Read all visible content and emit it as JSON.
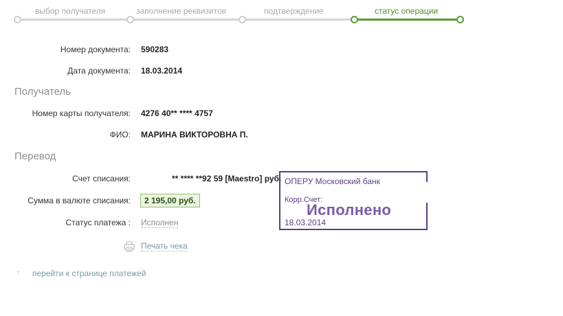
{
  "steps": [
    {
      "label": "выбор получателя",
      "active": false
    },
    {
      "label": "заполнение реквизитов",
      "active": false
    },
    {
      "label": "подтверждение",
      "active": false
    },
    {
      "label": "статус операции",
      "active": true
    }
  ],
  "document": {
    "number_label": "Номер документа:",
    "number_value": "590283",
    "date_label": "Дата документа:",
    "date_value": "18.03.2014"
  },
  "recipient": {
    "section_title": "Получатель",
    "card_label": "Номер карты получателя:",
    "card_value": "4276 40** **** 4757",
    "name_label": "ФИО:",
    "name_value": "МАРИНА ВИКТОРОВНА П."
  },
  "transfer": {
    "section_title": "Перевод",
    "account_label": "Счет списания:",
    "account_value": "** **** **92 59  [Maestro]  руб.",
    "amount_label": "Сумма в валюте списания:",
    "amount_value": "2 195,00  руб.",
    "status_label": "Статус платежа :",
    "status_value": "Исполнен"
  },
  "actions": {
    "print_label": "Печать чека",
    "back_label": "перейти к странице платежей"
  },
  "stamp": {
    "bank": "ОПЕРУ Московский банк",
    "corr_label": "Корр.Счет:",
    "status": "Исполнено",
    "date": "18.03.2014"
  },
  "colors": {
    "accent_green": "#5a9c32",
    "stamp_purple": "#5a3f86"
  }
}
